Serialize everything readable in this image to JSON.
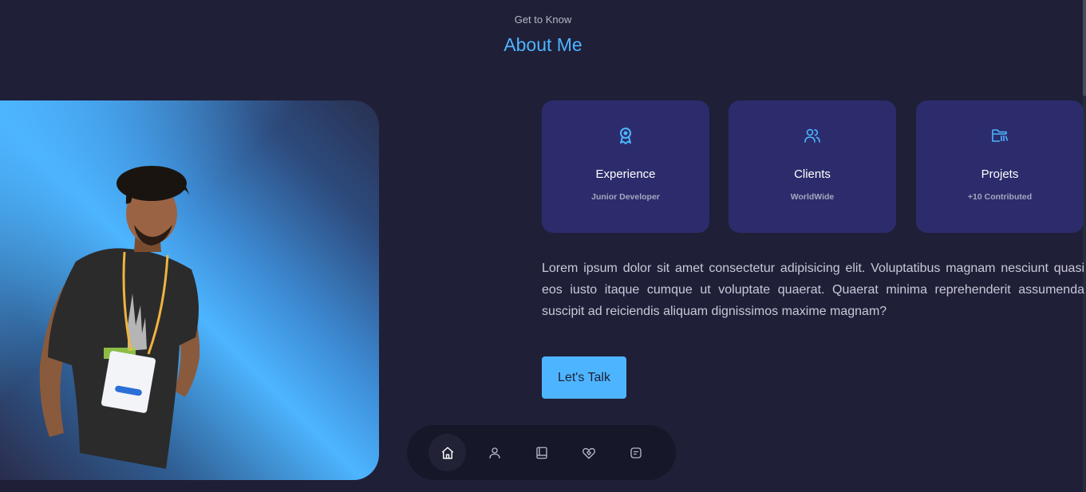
{
  "header": {
    "subtitle": "Get to Know",
    "title": "About Me"
  },
  "cards": [
    {
      "icon": "award-icon",
      "title": "Experience",
      "subtitle": "Junior Developer"
    },
    {
      "icon": "users-icon",
      "title": "Clients",
      "subtitle": "WorldWide"
    },
    {
      "icon": "folder-icon",
      "title": "Projets",
      "subtitle": "+10 Contributed"
    }
  ],
  "about_text": "Lorem ipsum dolor sit amet consectetur adipisicing elit. Voluptatibus magnam nesciunt quasi eos iusto itaque cumque ut voluptate quaerat. Quaerat minima reprehenderit assumenda suscipit ad reiciendis aliquam dignissimos maxime magnam?",
  "cta_label": "Let's Talk",
  "nav": {
    "items": [
      {
        "icon": "home-icon",
        "active": true
      },
      {
        "icon": "user-icon",
        "active": false
      },
      {
        "icon": "book-icon",
        "active": false
      },
      {
        "icon": "services-icon",
        "active": false
      },
      {
        "icon": "message-icon",
        "active": false
      }
    ]
  },
  "colors": {
    "background": "#1f1f38",
    "accent": "#4db5ff",
    "card": "#2c2c6c",
    "nav": "#17172a"
  }
}
